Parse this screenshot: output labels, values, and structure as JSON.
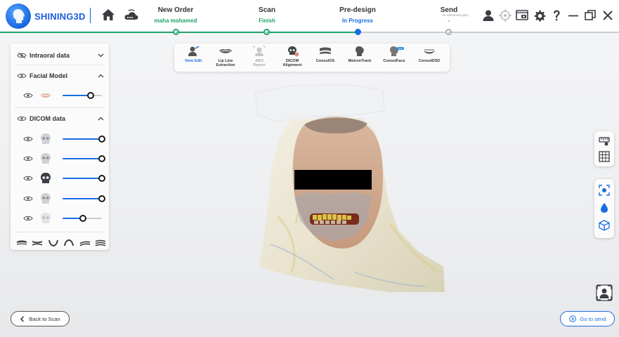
{
  "app": {
    "brand": "SHINING3D",
    "accent": "#1a6de0",
    "success": "#1ea36b"
  },
  "workflow": {
    "steps": [
      {
        "title": "New Order",
        "status": "maha mohamed",
        "state": "done"
      },
      {
        "title": "Scan",
        "status": "Finish",
        "state": "done"
      },
      {
        "title": "Pre-design",
        "status": "In Progress",
        "state": "active"
      },
      {
        "title": "Send",
        "status": "-",
        "state": "pending"
      }
    ],
    "send_user": "Dr Mohamed gaby"
  },
  "header_icons": [
    "home-icon",
    "cloud-icon",
    "user-icon",
    "target-icon",
    "screenshot-icon",
    "gear-icon",
    "help-icon",
    "minimize-icon",
    "restore-icon",
    "close-icon"
  ],
  "left_panel": {
    "intraoral": {
      "label": "Intraoral data",
      "expanded": false
    },
    "facial": {
      "label": "Facial Model",
      "expanded": true,
      "items": [
        {
          "icon": "lips-icon",
          "opacity": 0.72
        }
      ]
    },
    "dicom": {
      "label": "DICOM data",
      "expanded": true,
      "items": [
        {
          "icon": "skull-icon",
          "opacity": 1.0
        },
        {
          "icon": "skull-icon",
          "opacity": 1.0
        },
        {
          "icon": "skull-dark-icon",
          "opacity": 1.0
        },
        {
          "icon": "skull-icon",
          "opacity": 1.0
        },
        {
          "icon": "skull-faint-icon",
          "opacity": 0.5
        }
      ]
    },
    "bottom_icons": [
      "upper-jaw-icon",
      "both-jaws-icon",
      "lower-jaw-icon",
      "arch-icon",
      "occlusion-icon",
      "stack-icon"
    ]
  },
  "toolbar": {
    "tools": [
      {
        "label": "View Edit",
        "state": "active"
      },
      {
        "label": "Lip Line Extraction",
        "state": "normal"
      },
      {
        "label": "ABO Report",
        "state": "disabled"
      },
      {
        "label": "DICOM Alignment",
        "state": "normal"
      },
      {
        "label": "ConsulOS",
        "state": "normal"
      },
      {
        "label": "MetronTrack",
        "state": "normal"
      },
      {
        "label": "ConsulFace",
        "state": "normal",
        "badge": "New"
      },
      {
        "label": "ConsulDSD",
        "state": "normal"
      }
    ]
  },
  "right_dock": {
    "group1": [
      "measure-icon",
      "grid-icon"
    ],
    "group2": [
      "capture-icon",
      "drop-icon",
      "cube-icon"
    ],
    "face_button": "face-frame-icon"
  },
  "footer": {
    "back_label": "Back to Scan",
    "next_label": "Go to send"
  }
}
